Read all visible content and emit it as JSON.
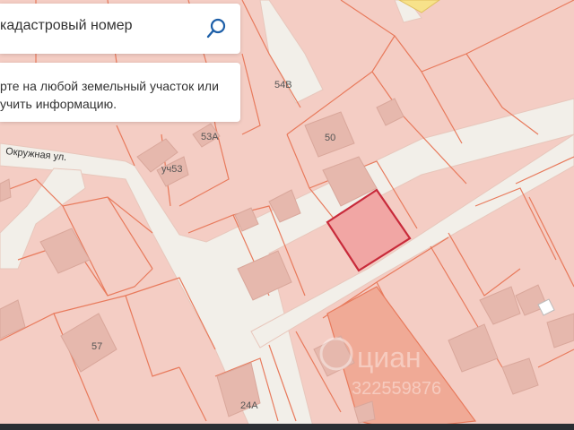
{
  "search": {
    "placeholder": "кадастровый номер"
  },
  "hint": {
    "text": "рте на любой земельный участок или\nучить информацию."
  },
  "map": {
    "street_name": "Окружная ул.",
    "parcel_labels": [
      "54В",
      "53А",
      "50",
      "уч53",
      "57",
      "24А"
    ],
    "watermark_brand": "циан",
    "watermark_number": "322559876"
  },
  "colors": {
    "parcel_fill": "#f4cdc4",
    "parcel_stroke": "#e87a5c",
    "building": "#e6b8ad",
    "road": "#f2efe9",
    "selected_stroke": "#c82a3a",
    "accent": "#1d5fa8"
  }
}
